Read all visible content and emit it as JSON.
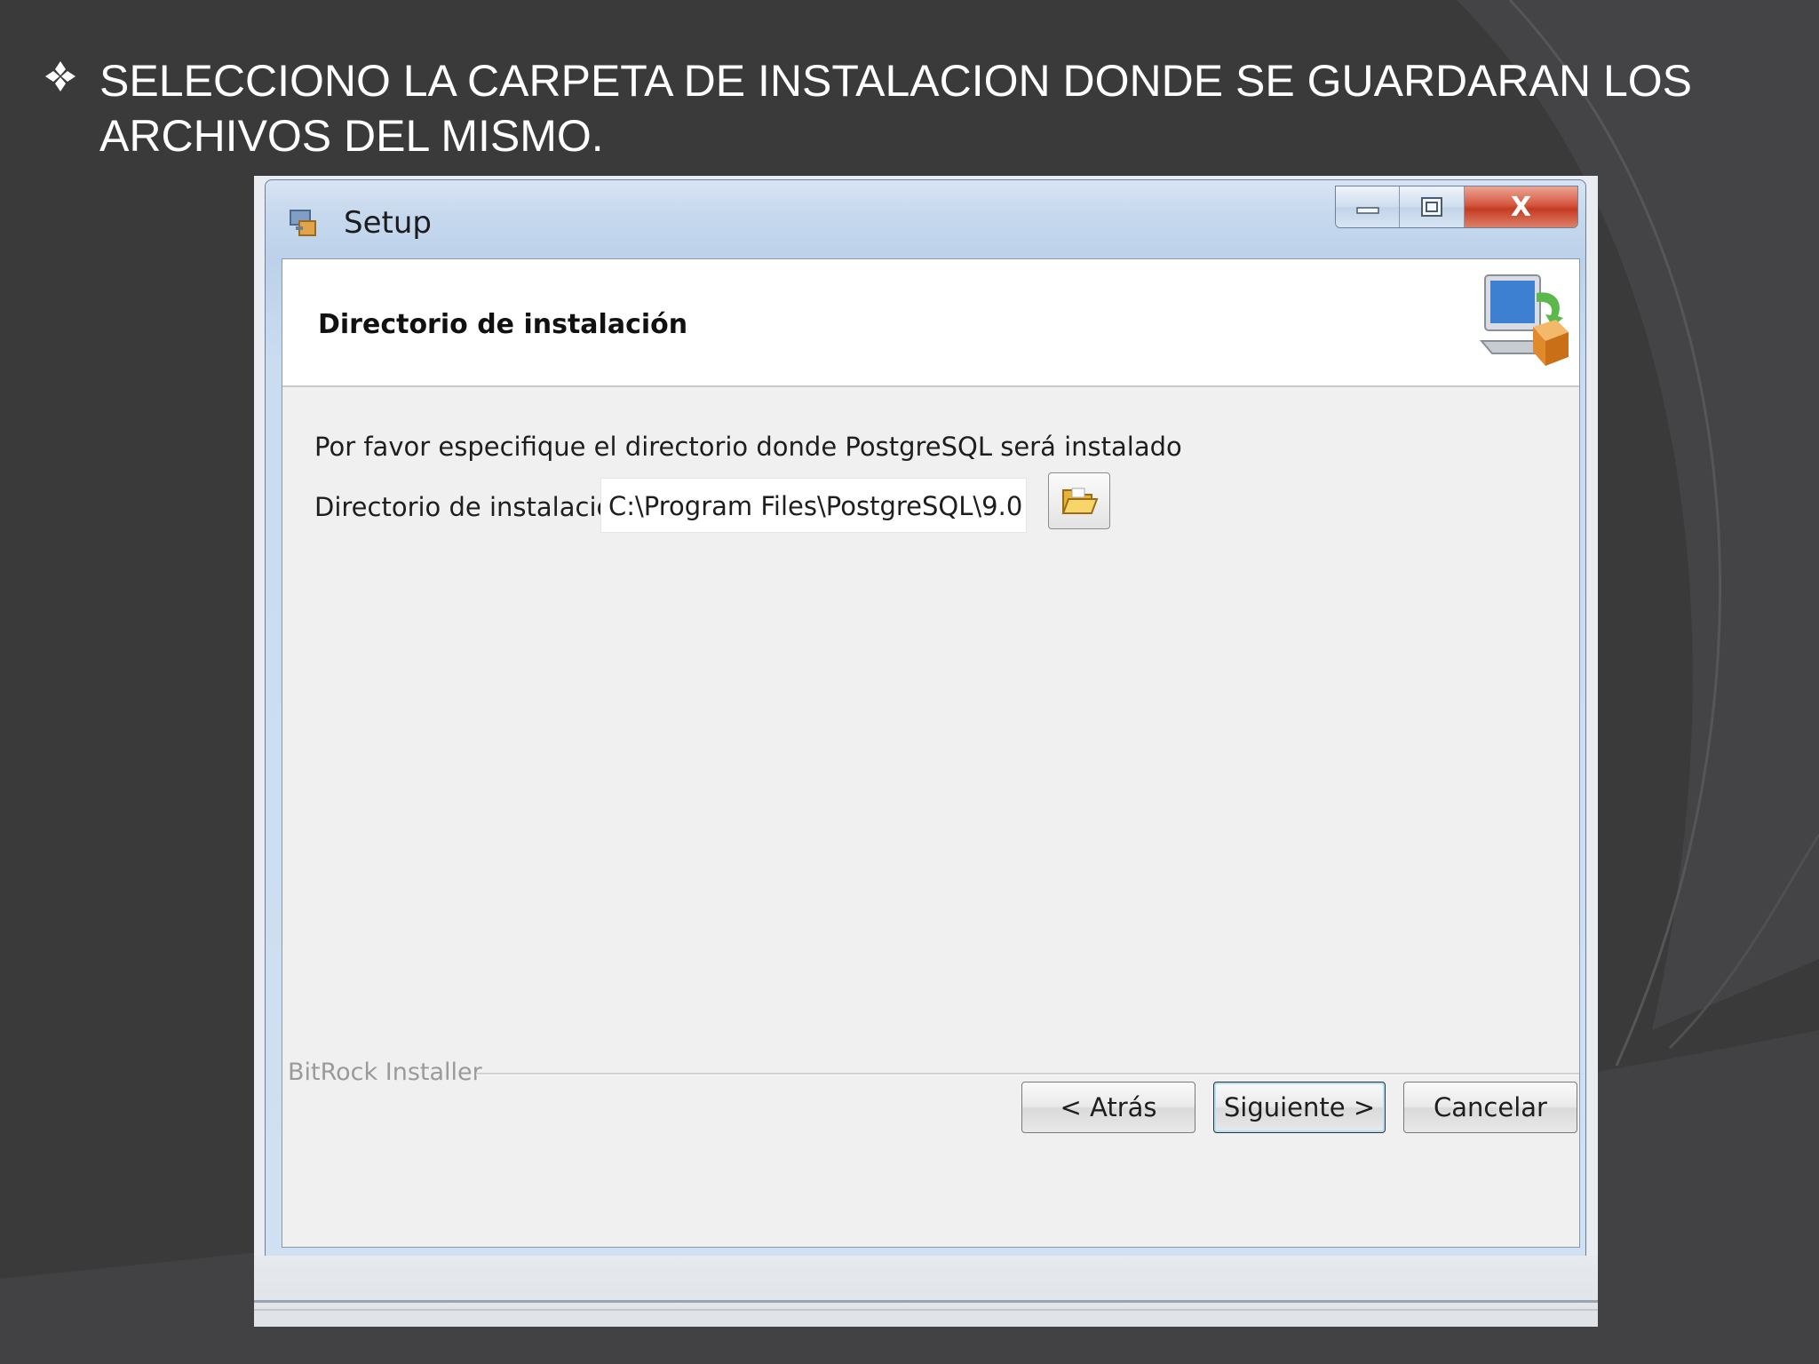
{
  "slide": {
    "bullet_icon": "diamond-bullet-icon",
    "text": "SELECCIONO LA  CARPETA DE INSTALACION DONDE SE GUARDARAN LOS ARCHIVOS DEL MISMO."
  },
  "window": {
    "title": "Setup",
    "app_icon": "setup-icon",
    "controls": {
      "minimize": "minimize-icon",
      "maximize": "maximize-icon",
      "close_label": "X"
    }
  },
  "header": {
    "title": "Directorio de instalación",
    "icon": "computer-install-icon"
  },
  "body": {
    "prompt": "Por favor especifique el directorio donde PostgreSQL será instalado",
    "dir_label": "Directorio de instalación",
    "dir_value": "C:\\Program Files\\PostgreSQL\\9.0",
    "browse_icon": "folder-open-icon"
  },
  "footer": {
    "brand": "BitRock Installer",
    "back_label": "< Atrás",
    "next_label": "Siguiente >",
    "cancel_label": "Cancelar"
  },
  "colors": {
    "slide_background": "#3a3a3b",
    "title_bar": "#c6d8ee",
    "close_button": "#c53a22",
    "client_background": "#f0f0f0"
  }
}
